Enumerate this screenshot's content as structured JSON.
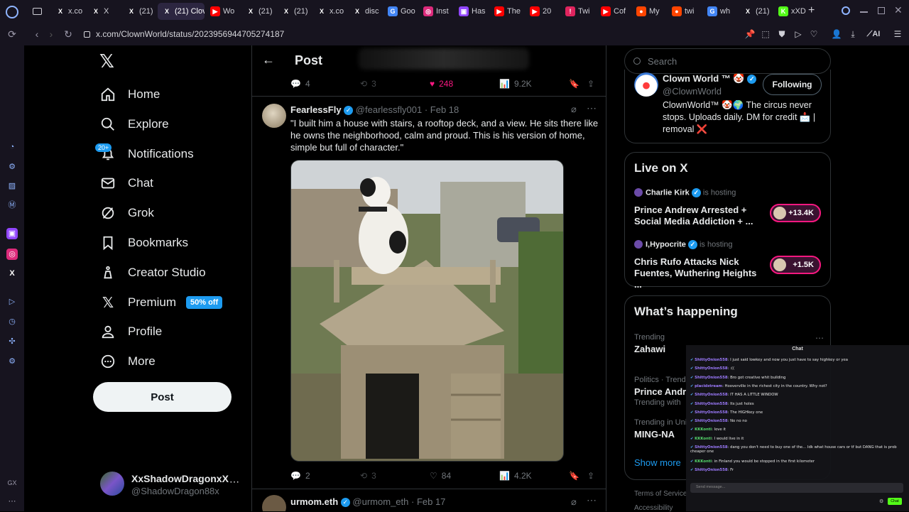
{
  "browser": {
    "tabs": [
      {
        "label": "x.co",
        "icon": "X",
        "color": "#000000",
        "active": false
      },
      {
        "label": "X",
        "icon": "X",
        "color": "#000000",
        "active": false
      },
      {
        "label": "(21)",
        "icon": "X",
        "color": "#000000",
        "active": false
      },
      {
        "label": "(21) Clov",
        "icon": "X",
        "color": "#000000",
        "active": true
      },
      {
        "label": "Wo",
        "icon": "▶",
        "color": "#ff0000",
        "active": false
      },
      {
        "label": "(21)",
        "icon": "X",
        "color": "#000000",
        "active": false
      },
      {
        "label": "(21)",
        "icon": "X",
        "color": "#000000",
        "active": false
      },
      {
        "label": "x.co",
        "icon": "X",
        "color": "#000000",
        "active": false
      },
      {
        "label": "disc",
        "icon": "X",
        "color": "#000000",
        "active": false
      },
      {
        "label": "Goo",
        "icon": "G",
        "color": "#4285f4",
        "active": false
      },
      {
        "label": "Inst",
        "icon": "◎",
        "color": "#dd2a7b",
        "active": false
      },
      {
        "label": "Has",
        "icon": "▣",
        "color": "#9146ff",
        "active": false
      },
      {
        "label": "The",
        "icon": "▶",
        "color": "#ff0000",
        "active": false
      },
      {
        "label": "20",
        "icon": "▶",
        "color": "#ff0000",
        "active": false
      },
      {
        "label": "Twi",
        "icon": "!",
        "color": "#e0245e",
        "active": false
      },
      {
        "label": "Cof",
        "icon": "▶",
        "color": "#ff0000",
        "active": false
      },
      {
        "label": "My",
        "icon": "●",
        "color": "#ff4500",
        "active": false
      },
      {
        "label": "twi",
        "icon": "●",
        "color": "#ff4500",
        "active": false
      },
      {
        "label": "wh",
        "icon": "G",
        "color": "#4285f4",
        "active": false
      },
      {
        "label": "(21)",
        "icon": "X",
        "color": "#000000",
        "active": false
      },
      {
        "label": "xXD",
        "icon": "K",
        "color": "#53fc18",
        "active": false
      }
    ],
    "url": "x.com/ClownWorld/status/2023956944705274187",
    "ai_label": "AI",
    "gx_label": "GX"
  },
  "nav": {
    "home": "Home",
    "explore": "Explore",
    "notifications": "Notifications",
    "notifications_badge": "20+",
    "chat": "Chat",
    "grok": "Grok",
    "bookmarks": "Bookmarks",
    "creator_studio": "Creator Studio",
    "premium": "Premium",
    "premium_badge": "50% off",
    "profile": "Profile",
    "more": "More",
    "post_button": "Post",
    "account_name": "XxShadowDragonxX",
    "account_handle": "@ShadowDragon88x"
  },
  "header": {
    "title": "Post"
  },
  "prev_post": {
    "replies": "4",
    "reposts": "3",
    "likes": "248",
    "views": "9.2K"
  },
  "post": {
    "author": "FearlessFly",
    "handle": "@fearlessfly001",
    "date": "· Feb 18",
    "text": "\"I built him a house with stairs, a rooftop deck, and a view. He sits there like he owns the neighborhood, calm and proud. This is his version of home, simple but full of character.\"",
    "replies": "2",
    "reposts": "3",
    "likes": "84",
    "views": "4.2K"
  },
  "next_post": {
    "author": "urmom.eth",
    "handle": "@urmom_eth",
    "date": "· Feb 17"
  },
  "search": {
    "placeholder": "Search"
  },
  "profile_card": {
    "name": "Clown World ™ 🤡",
    "handle": "@ClownWorld",
    "follow_label": "Following",
    "bio": "ClownWorld™ 🤡🌍 The circus never stops. Uploads daily. DM for credit 📩 | removal ❌"
  },
  "live": {
    "title": "Live on X",
    "items": [
      {
        "host": "Charlie Kirk",
        "status": "is hosting",
        "title": "Prince Andrew Arrested + Social Media Addiction + ...",
        "count": "+13.4K"
      },
      {
        "host": "I,Hypocrite",
        "status": "is hosting",
        "title": "Chris Rufo Attacks Nick Fuentes, Wuthering Heights ...",
        "count": "+1.5K"
      }
    ]
  },
  "happening": {
    "title": "What’s happening",
    "items": [
      {
        "context": "Trending",
        "topic": "Zahawi",
        "extra": ""
      },
      {
        "context": "Politics · Trend",
        "topic": "Prince Andr",
        "extra": "Trending with"
      },
      {
        "context": "Trending in Uni",
        "topic": "MING-NA",
        "extra": ""
      }
    ],
    "show_more": "Show more",
    "footer_terms": "Terms of Service",
    "footer_access": "Accessibility"
  },
  "chat": {
    "title": "Chat",
    "messages": [
      {
        "user": "ShittyOnion558",
        "text": ": I just said lowkey and now you just have to say highkey or yea",
        "green": false
      },
      {
        "user": "ShittyOnion558",
        "text": ": :((",
        "green": false
      },
      {
        "user": "ShittyOnion558",
        "text": ": Bro got creative whit building",
        "green": false
      },
      {
        "user": "placidstream",
        "text": ": Hooverville in the richest city in the country. Why not?",
        "green": false
      },
      {
        "user": "ShittyOnion558",
        "text": ": IT HAS A LITTLE WINDOW",
        "green": false
      },
      {
        "user": "ShittyOnion558",
        "text": ": Its just holes",
        "green": false
      },
      {
        "user": "ShittyOnion558",
        "text": ": The HIGHkey one",
        "green": false
      },
      {
        "user": "ShittyOnion558",
        "text": ": No no no",
        "green": false
      },
      {
        "user": "KKKonti",
        "text": ": love it",
        "green": true
      },
      {
        "user": "KKKonti",
        "text": ": I would live in it",
        "green": true
      },
      {
        "user": "ShittyOnion558",
        "text": ": dang you don't need to buy one of the... Idk what house cars or tf but DANG that is prob cheaper one",
        "green": false
      },
      {
        "user": "KKKonti",
        "text": ": in Finland you would be stopped in the first kilometer",
        "green": true
      },
      {
        "user": "ShittyOnion558",
        "text": ": Fr",
        "green": false
      }
    ],
    "placeholder": "Send message...",
    "send_label": "Chat"
  }
}
